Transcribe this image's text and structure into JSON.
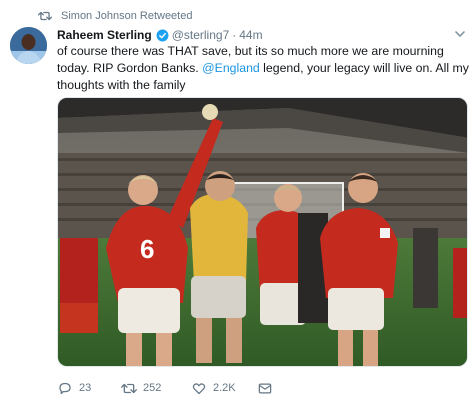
{
  "retweet_context": {
    "text": "Simon Johnson Retweeted",
    "icon": "retweet-icon"
  },
  "author": {
    "name": "Raheem Sterling",
    "handle": "@sterling7",
    "separator": "·",
    "time": "44m",
    "verified_icon": "verified-badge-icon"
  },
  "tweet": {
    "text_part1": "of course there was THAT save, but its so much more we are mourning today. RIP Gordon Banks. ",
    "mention": "@England",
    "text_part2": " legend, your legacy will live on. All my thoughts with the family"
  },
  "media": {
    "jersey_number": "6"
  },
  "actions": {
    "reply_count": "23",
    "retweet_count": "252",
    "like_count": "2.2K"
  },
  "colors": {
    "link": "#1b95e0",
    "muted": "#657786",
    "verified": "#1da1f2"
  }
}
